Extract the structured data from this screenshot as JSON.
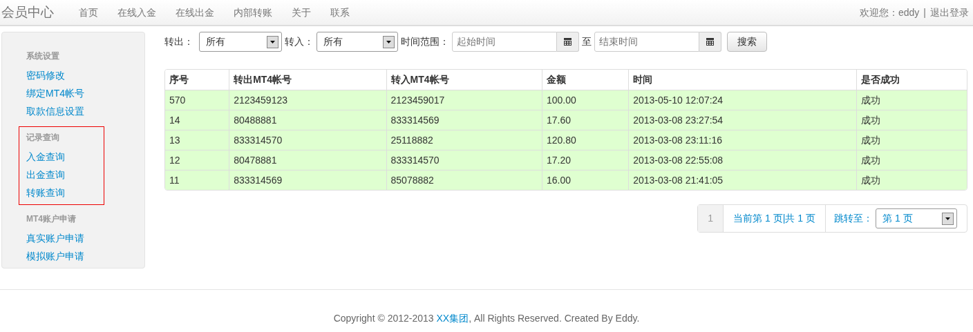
{
  "navbar": {
    "brand": "会员中心",
    "links": [
      {
        "label": "首页",
        "selected": false
      },
      {
        "label": "在线入金",
        "selected": false
      },
      {
        "label": "在线出金",
        "selected": false
      },
      {
        "label": "内部转账",
        "selected": false
      },
      {
        "label": "关于",
        "selected": false
      },
      {
        "label": "联系",
        "selected": false
      }
    ],
    "welcome": "欢迎您：eddy",
    "separator": "|",
    "logout": "退出登录"
  },
  "sidebar": {
    "groups": [
      {
        "heading": "系统设置",
        "highlighted": false,
        "items": [
          "密码修改",
          "绑定MT4帐号",
          "取款信息设置"
        ]
      },
      {
        "heading": "记录查询",
        "highlighted": true,
        "items": [
          "入金查询",
          "出金查询",
          "转账查询"
        ]
      },
      {
        "heading": "MT4账户申请",
        "highlighted": false,
        "items": [
          "真实账户申请",
          "模拟账户申请"
        ]
      }
    ]
  },
  "filters": {
    "out_label": "转出：",
    "out_value": "所有",
    "in_label": "转入：",
    "in_value": "所有",
    "range_label": "时间范围：",
    "start_placeholder": "起始时间",
    "to_label": "至",
    "end_placeholder": "结束时间",
    "search_button": "搜索"
  },
  "table": {
    "columns": [
      "序号",
      "转出MT4帐号",
      "转入MT4帐号",
      "金额",
      "时间",
      "是否成功"
    ],
    "rows": [
      [
        "570",
        "2123459123",
        "2123459017",
        "100.00",
        "2013-05-10 12:07:24",
        "成功"
      ],
      [
        "14",
        "80488881",
        "833314569",
        "17.60",
        "2013-03-08 23:27:54",
        "成功"
      ],
      [
        "13",
        "833314570",
        "25118882",
        "120.80",
        "2013-03-08 23:11:16",
        "成功"
      ],
      [
        "12",
        "80478881",
        "833314570",
        "17.20",
        "2013-03-08 22:55:08",
        "成功"
      ],
      [
        "11",
        "833314569",
        "85078882",
        "16.00",
        "2013-03-08 21:41:05",
        "成功"
      ]
    ]
  },
  "pagination": {
    "page": "1",
    "info": "当前第 1 页|共 1 页",
    "jump_label": "跳转至：",
    "jump_value": "第 1 页"
  },
  "footer": {
    "before": "Copyright © 2012-2013 ",
    "link": "XX集团",
    "after": ", All Rights Reserved. Created By Eddy."
  }
}
